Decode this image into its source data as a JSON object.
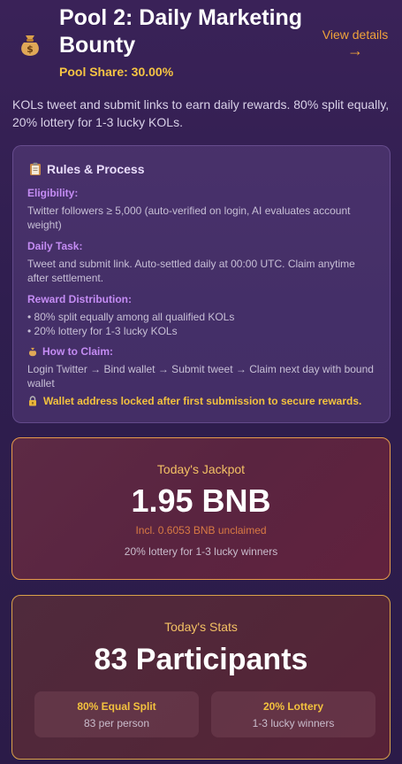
{
  "header": {
    "title": "Pool 2: Daily Marketing Bounty",
    "pool_share": "Pool Share: 30.00%",
    "view_details_label": "View details",
    "view_details_arrow": "→",
    "icon": "money-bag-icon"
  },
  "description": "KOLs tweet and submit links to earn daily rewards. 80% split equally, 20% lottery for 1-3 lucky KOLs.",
  "rules": {
    "title": "Rules & Process",
    "icon": "clipboard-icon",
    "eligibility_heading": "Eligibility:",
    "eligibility_text": "Twitter followers ≥ 5,000 (auto-verified on login, AI evaluates account weight)",
    "daily_task_heading": "Daily Task:",
    "daily_task_text": "Tweet and submit link. Auto-settled daily at 00:00 UTC. Claim anytime after settlement.",
    "reward_heading": "Reward Distribution:",
    "reward_items": [
      "• 80% split equally among all qualified KOLs",
      "• 20% lottery for 1-3 lucky KOLs"
    ],
    "claim_heading": "How to Claim:",
    "claim_text": "Login Twitter → Bind wallet → Submit tweet → Claim next day with bound wallet",
    "lock_notice": "Wallet address locked after first submission to secure rewards."
  },
  "jackpot": {
    "label": "Today's Jackpot",
    "value": "1.95 BNB",
    "unclaimed": "Incl. 0.6053 BNB unclaimed",
    "note": "20% lottery for 1-3 lucky winners"
  },
  "stats": {
    "label": "Today's Stats",
    "value": "83 Participants",
    "equal_split_heading": "80% Equal Split",
    "equal_split_text": "83 per person",
    "lottery_heading": "20% Lottery",
    "lottery_text": "1-3 lucky winners"
  },
  "colors": {
    "accent_gold": "#f6c443",
    "accent_orange": "#f0a33a",
    "section_purple": "#c48cf4"
  }
}
